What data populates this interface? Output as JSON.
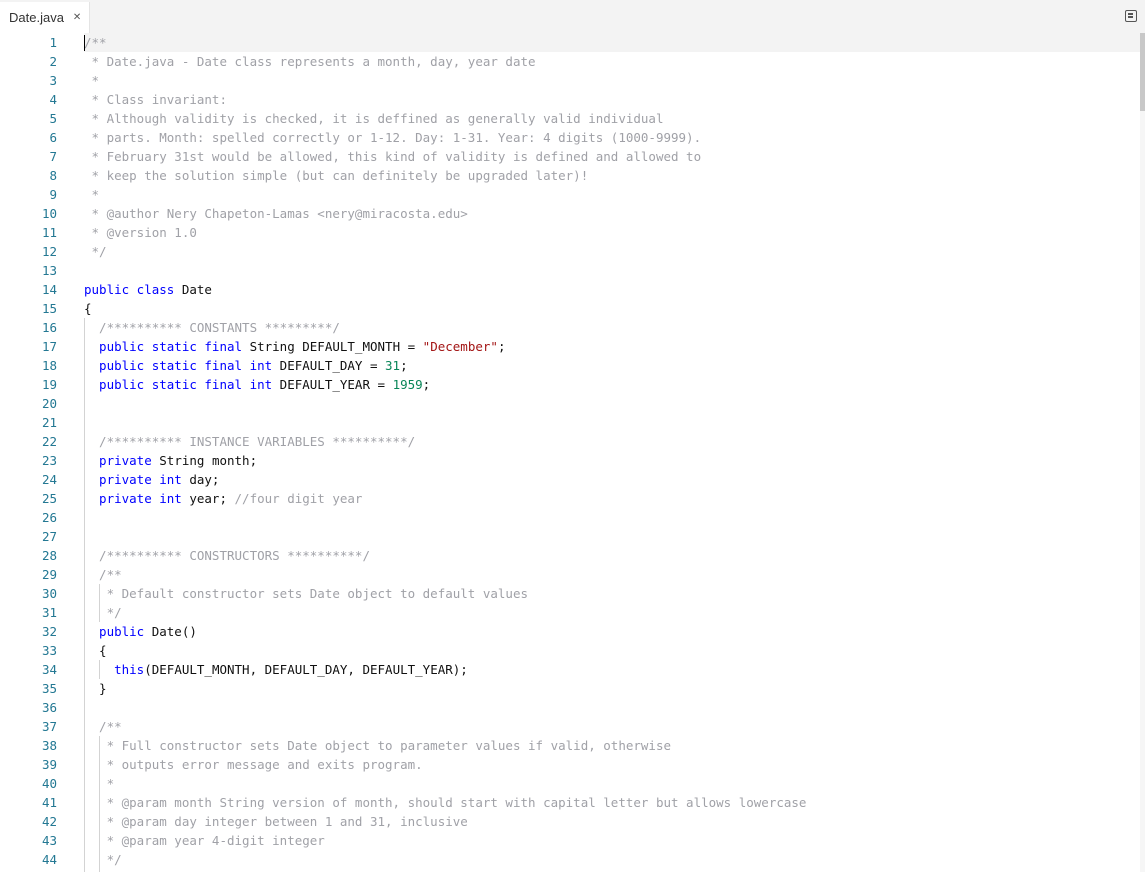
{
  "tab": {
    "title": "Date.java",
    "close_icon": "close-icon"
  },
  "toolbar": {
    "menu_icon": "menu-icon"
  },
  "colors": {
    "comment": "#a0a1a7",
    "keyword": "#0000ff",
    "string": "#a31515",
    "number": "#098658",
    "line_number": "#237893"
  },
  "lines": [
    {
      "n": "1",
      "tokens": [
        {
          "t": "/**",
          "c": "cm"
        }
      ]
    },
    {
      "n": "2",
      "tokens": [
        {
          "t": " * Date.java - Date class represents a month, day, year date",
          "c": "cm"
        }
      ]
    },
    {
      "n": "3",
      "tokens": [
        {
          "t": " *",
          "c": "cm"
        }
      ]
    },
    {
      "n": "4",
      "tokens": [
        {
          "t": " * Class invariant:",
          "c": "cm"
        }
      ]
    },
    {
      "n": "5",
      "tokens": [
        {
          "t": " * Although validity is checked, it is deffined as generally valid individual",
          "c": "cm"
        }
      ]
    },
    {
      "n": "6",
      "tokens": [
        {
          "t": " * parts. Month: spelled correctly or 1-12. Day: 1-31. Year: 4 digits (1000-9999).",
          "c": "cm"
        }
      ]
    },
    {
      "n": "7",
      "tokens": [
        {
          "t": " * February 31st would be allowed, this kind of validity is defined and allowed to",
          "c": "cm"
        }
      ]
    },
    {
      "n": "8",
      "tokens": [
        {
          "t": " * keep the solution simple (but can definitely be upgraded later)!",
          "c": "cm"
        }
      ]
    },
    {
      "n": "9",
      "tokens": [
        {
          "t": " *",
          "c": "cm"
        }
      ]
    },
    {
      "n": "10",
      "tokens": [
        {
          "t": " * @author Nery Chapeton-Lamas <nery@miracosta.edu>",
          "c": "cm"
        }
      ]
    },
    {
      "n": "11",
      "tokens": [
        {
          "t": " * @version 1.0",
          "c": "cm"
        }
      ]
    },
    {
      "n": "12",
      "tokens": [
        {
          "t": " */",
          "c": "cm"
        }
      ]
    },
    {
      "n": "13",
      "tokens": []
    },
    {
      "n": "14",
      "tokens": [
        {
          "t": "public class ",
          "c": "kw"
        },
        {
          "t": "Date",
          "c": "pl"
        }
      ]
    },
    {
      "n": "15",
      "tokens": [
        {
          "t": "{",
          "c": "pl"
        }
      ]
    },
    {
      "n": "16",
      "tokens": [
        {
          "t": "  /********** CONSTANTS *********/",
          "c": "cm"
        }
      ]
    },
    {
      "n": "17",
      "tokens": [
        {
          "t": "  public static final ",
          "c": "kw"
        },
        {
          "t": "String DEFAULT_MONTH = ",
          "c": "pl"
        },
        {
          "t": "\"December\"",
          "c": "str"
        },
        {
          "t": ";",
          "c": "pl"
        }
      ]
    },
    {
      "n": "18",
      "tokens": [
        {
          "t": "  public static final int ",
          "c": "kw"
        },
        {
          "t": "DEFAULT_DAY = ",
          "c": "pl"
        },
        {
          "t": "31",
          "c": "num"
        },
        {
          "t": ";",
          "c": "pl"
        }
      ]
    },
    {
      "n": "19",
      "tokens": [
        {
          "t": "  public static final int ",
          "c": "kw"
        },
        {
          "t": "DEFAULT_YEAR = ",
          "c": "pl"
        },
        {
          "t": "1959",
          "c": "num"
        },
        {
          "t": ";",
          "c": "pl"
        }
      ]
    },
    {
      "n": "20",
      "tokens": []
    },
    {
      "n": "21",
      "tokens": []
    },
    {
      "n": "22",
      "tokens": [
        {
          "t": "  /********** INSTANCE VARIABLES **********/",
          "c": "cm"
        }
      ]
    },
    {
      "n": "23",
      "tokens": [
        {
          "t": "  private ",
          "c": "kw"
        },
        {
          "t": "String month;",
          "c": "pl"
        }
      ]
    },
    {
      "n": "24",
      "tokens": [
        {
          "t": "  private int ",
          "c": "kw"
        },
        {
          "t": "day;",
          "c": "pl"
        }
      ]
    },
    {
      "n": "25",
      "tokens": [
        {
          "t": "  private int ",
          "c": "kw"
        },
        {
          "t": "year; ",
          "c": "pl"
        },
        {
          "t": "//four digit year",
          "c": "cm"
        }
      ]
    },
    {
      "n": "26",
      "tokens": []
    },
    {
      "n": "27",
      "tokens": []
    },
    {
      "n": "28",
      "tokens": [
        {
          "t": "  /********** CONSTRUCTORS **********/",
          "c": "cm"
        }
      ]
    },
    {
      "n": "29",
      "tokens": [
        {
          "t": "  /**",
          "c": "cm"
        }
      ]
    },
    {
      "n": "30",
      "tokens": [
        {
          "t": "   * Default constructor sets Date object to default values",
          "c": "cm"
        }
      ]
    },
    {
      "n": "31",
      "tokens": [
        {
          "t": "   */",
          "c": "cm"
        }
      ]
    },
    {
      "n": "32",
      "tokens": [
        {
          "t": "  public ",
          "c": "kw"
        },
        {
          "t": "Date()",
          "c": "pl"
        }
      ]
    },
    {
      "n": "33",
      "tokens": [
        {
          "t": "  {",
          "c": "pl"
        }
      ]
    },
    {
      "n": "34",
      "tokens": [
        {
          "t": "    this",
          "c": "kw"
        },
        {
          "t": "(DEFAULT_MONTH, DEFAULT_DAY, DEFAULT_YEAR);",
          "c": "pl"
        }
      ]
    },
    {
      "n": "35",
      "tokens": [
        {
          "t": "  }",
          "c": "pl"
        }
      ]
    },
    {
      "n": "36",
      "tokens": []
    },
    {
      "n": "37",
      "tokens": [
        {
          "t": "  /**",
          "c": "cm"
        }
      ]
    },
    {
      "n": "38",
      "tokens": [
        {
          "t": "   * Full constructor sets Date object to parameter values if valid, otherwise",
          "c": "cm"
        }
      ]
    },
    {
      "n": "39",
      "tokens": [
        {
          "t": "   * outputs error message and exits program.",
          "c": "cm"
        }
      ]
    },
    {
      "n": "40",
      "tokens": [
        {
          "t": "   *",
          "c": "cm"
        }
      ]
    },
    {
      "n": "41",
      "tokens": [
        {
          "t": "   * @param month String version of month, should start with capital letter but allows lowercase",
          "c": "cm"
        }
      ]
    },
    {
      "n": "42",
      "tokens": [
        {
          "t": "   * @param day integer between 1 and 31, inclusive",
          "c": "cm"
        }
      ]
    },
    {
      "n": "43",
      "tokens": [
        {
          "t": "   * @param year 4-digit integer",
          "c": "cm"
        }
      ]
    },
    {
      "n": "44",
      "tokens": [
        {
          "t": "   */",
          "c": "cm"
        }
      ]
    }
  ]
}
